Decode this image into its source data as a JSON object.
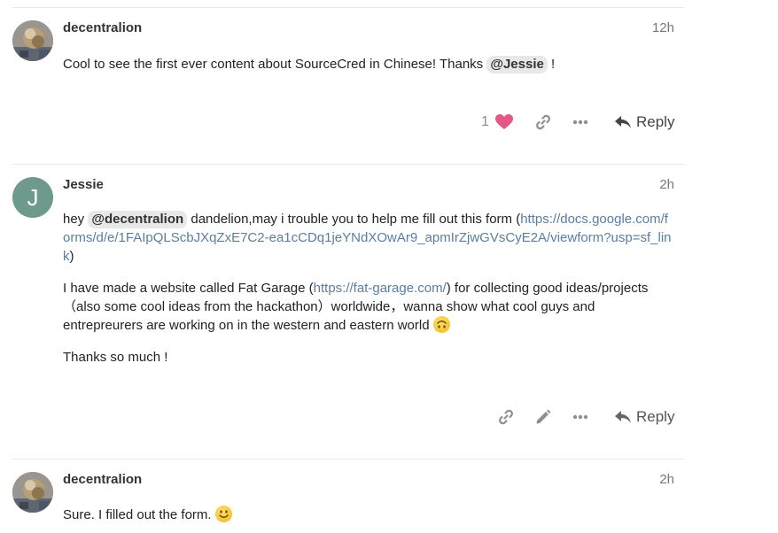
{
  "posts": [
    {
      "username": "decentralion",
      "time": "12h",
      "avatar_alt": "decentralion avatar",
      "body": {
        "text_before": "Cool to see the first ever content about SourceCred in Chinese! Thanks ",
        "mention": "@Jessie",
        "text_after": " !"
      },
      "actions": {
        "like_count": "1",
        "reply_label": "Reply"
      }
    },
    {
      "username": "Jessie",
      "time": "2h",
      "avatar_letter": "J",
      "body": {
        "p1_prefix": "hey ",
        "p1_mention": "@decentralion",
        "p1_text": " dandelion,may i trouble you to help me fill out this form (",
        "p1_link": "https://docs.google.com/forms/d/e/1FAIpQLScbJXqZxE7C2-ea1cCDq1jeYNdXOwAr9_apmIrZjwGVsCyE2A/viewform?usp=sf_link",
        "p1_close": ")",
        "p2_text1": "I have made a website called Fat Garage (",
        "p2_link": "https://fat-garage.com/",
        "p2_text2": ") for collecting good ideas/projects （also some cool ideas from the hackathon）worldwide，wanna show what cool guys and entrepreurers are working on in the western and eastern world ",
        "p3_text": "Thanks so much !"
      },
      "actions": {
        "reply_label": "Reply"
      }
    },
    {
      "username": "decentralion",
      "time": "2h",
      "avatar_alt": "decentralion avatar",
      "body": {
        "text": "Sure. I filled out the form. "
      }
    }
  ],
  "icons": {
    "heart": "heart-icon",
    "link": "link-icon",
    "more": "more-icon",
    "edit": "pencil-icon",
    "reply": "reply-icon",
    "upside_down": "upside-down-face-emoji",
    "smile": "slightly-smiling-face-emoji"
  },
  "colors": {
    "heart": "#e45735",
    "link": "#5a7ea3",
    "mention_bg": "#e8e8e8",
    "jessie_avatar": "#6d9a8d"
  }
}
